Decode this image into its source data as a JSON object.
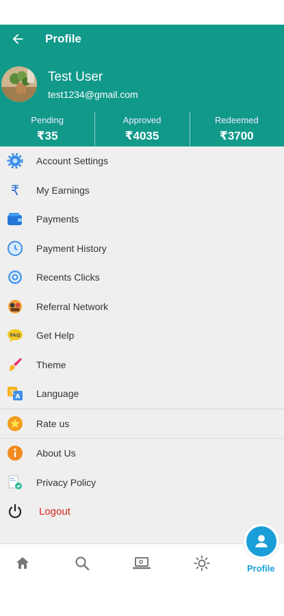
{
  "header": {
    "title": "Profile",
    "user_name": "Test User",
    "user_email": "test1234@gmail.com",
    "stats": [
      {
        "label": "Pending",
        "value": "₹35"
      },
      {
        "label": "Approved",
        "value": "₹4035"
      },
      {
        "label": "Redeemed",
        "value": "₹3700"
      }
    ],
    "colors": {
      "primary": "#11998a",
      "accent": "#1a9ed8",
      "logout": "#d9261c"
    }
  },
  "menu": {
    "items": [
      {
        "label": "Account Settings",
        "icon": "gear-icon"
      },
      {
        "label": "My Earnings",
        "icon": "rupee-icon"
      },
      {
        "label": "Payments",
        "icon": "wallet-icon"
      },
      {
        "label": "Payment History",
        "icon": "history-icon"
      },
      {
        "label": "Recents Clicks",
        "icon": "recent-clicks-icon"
      },
      {
        "label": "Referral Network",
        "icon": "referral-network-icon"
      },
      {
        "label": "Get Help",
        "icon": "faq-icon"
      },
      {
        "label": "Theme",
        "icon": "brush-icon"
      },
      {
        "label": "Language",
        "icon": "language-icon"
      },
      {
        "label": "Rate us",
        "icon": "star-icon"
      },
      {
        "label": "About Us",
        "icon": "info-icon"
      },
      {
        "label": "Privacy Policy",
        "icon": "privacy-policy-icon"
      }
    ],
    "logout_label": "Logout"
  },
  "bottom_nav": {
    "items": [
      "home-icon",
      "search-icon",
      "laptop-icon",
      "sun-icon"
    ],
    "active_label": "Profile"
  }
}
